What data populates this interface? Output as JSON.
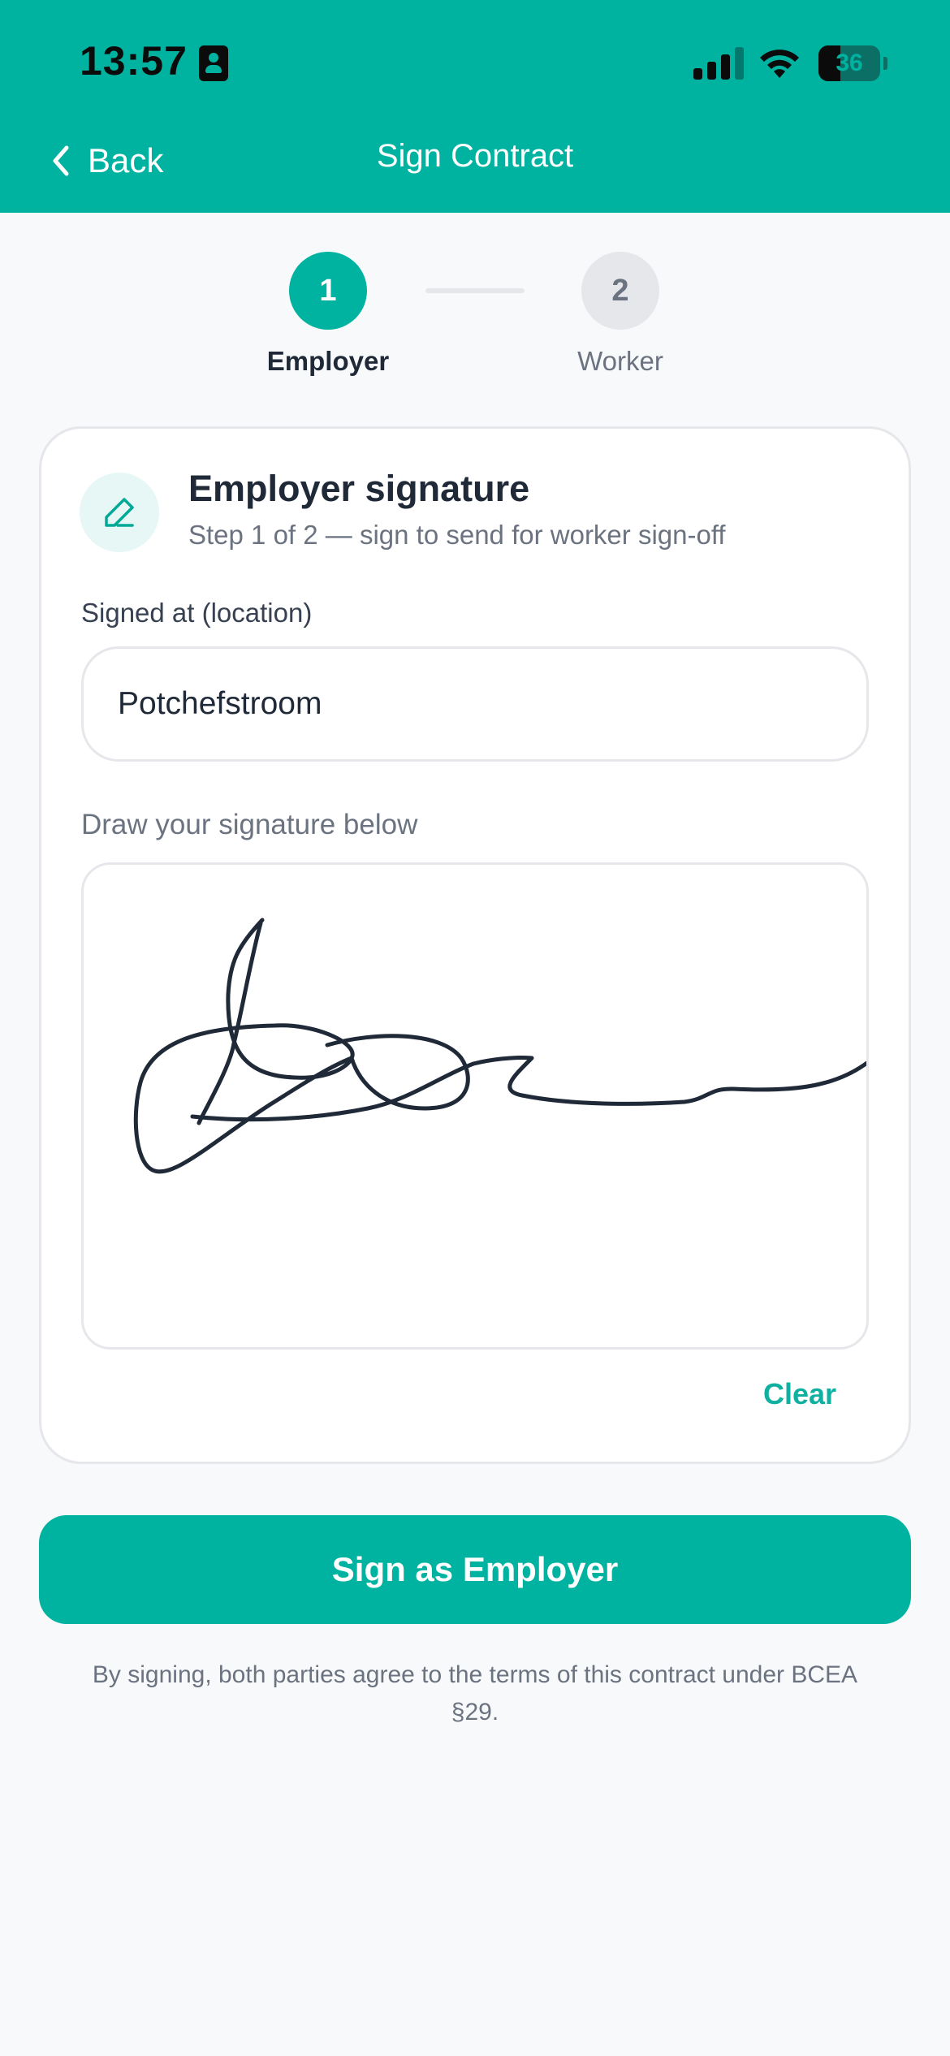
{
  "status_bar": {
    "time": "13:57",
    "battery": "36",
    "battery_level": 0.36
  },
  "header": {
    "back_label": "Back",
    "title": "Sign Contract",
    "bg_color": "#00b3a1"
  },
  "stepper": {
    "steps": [
      {
        "number": "1",
        "label": "Employer",
        "active": true
      },
      {
        "number": "2",
        "label": "Worker",
        "active": false
      }
    ]
  },
  "card": {
    "icon": "pen-icon",
    "title": "Employer signature",
    "subtitle": "Step 1 of 2 — sign to send for worker sign-off",
    "location_label": "Signed at (location)",
    "location_value": "Potchefstroom",
    "signature_label": "Draw your signature below",
    "clear_label": "Clear"
  },
  "actions": {
    "primary_label": "Sign as Employer"
  },
  "disclaimer": "By signing, both parties agree to the terms of this contract under BCEA §29.",
  "colors": {
    "accent": "#00b3a1",
    "text_primary": "#1f2937",
    "text_secondary": "#6b7280",
    "ink": "#1f2937"
  }
}
